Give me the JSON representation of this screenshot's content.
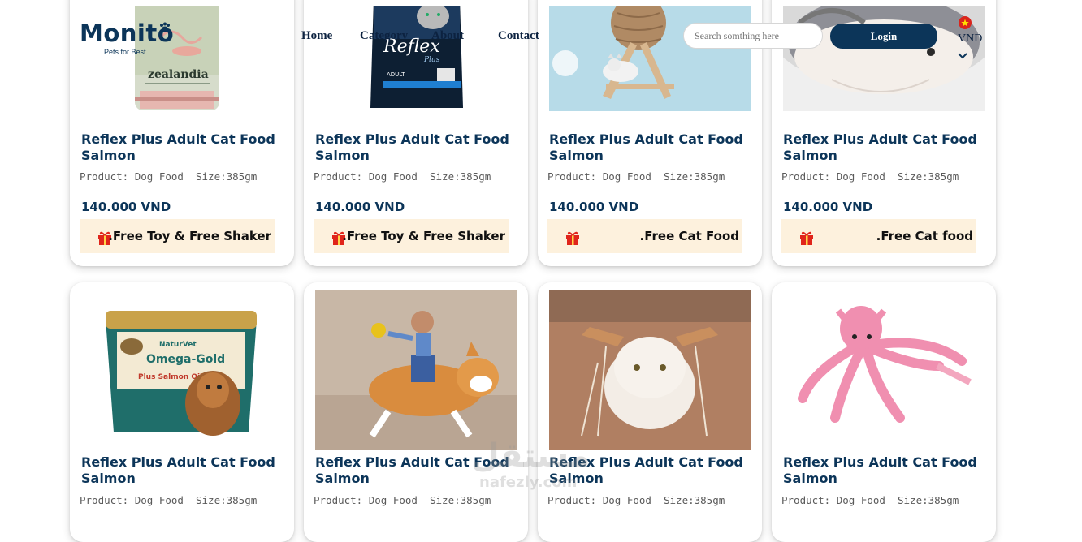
{
  "header": {
    "logo": "Monito",
    "tagline": "Pets for Best",
    "nav": [
      "Home",
      "Category",
      "About",
      "Contact"
    ],
    "search_placeholder": "Search somthing here",
    "login_label": "Login",
    "currency": "VND"
  },
  "products": [
    {
      "title": "Reflex Plus Adult Cat Food Salmon",
      "meta": "Product: Dog Food  Size:385gm",
      "price": "140.000 VND",
      "promo": ".Free Toy & Free Shaker",
      "image": "zealandia-can"
    },
    {
      "title": "Reflex Plus Adult Cat Food Salmon",
      "meta": "Product: Dog Food  Size:385gm",
      "price": "140.000 VND",
      "promo": ".Free Toy & Free Shaker",
      "image": "reflex-bag"
    },
    {
      "title": "Reflex Plus Adult Cat Food Salmon",
      "meta": "Product: Dog Food  Size:385gm",
      "price": "140.000 VND",
      "promo": ".Free Cat Food",
      "image": "cat-scratcher-ball"
    },
    {
      "title": "Reflex Plus Adult Cat Food Salmon",
      "meta": "Product: Dog Food  Size:385gm",
      "price": "140.000 VND",
      "promo": ".Free Cat food",
      "image": "shark-pet-bed"
    },
    {
      "title": "Reflex Plus Adult Cat Food Salmon",
      "meta": "Product: Dog Food  Size:385gm",
      "image": "naturvet-omega-gold"
    },
    {
      "title": "Reflex Plus Adult Cat Food Salmon",
      "meta": "Product: Dog Food  Size:385gm",
      "image": "corgi-rider-costume"
    },
    {
      "title": "Reflex Plus Adult Cat Food Salmon",
      "meta": "Product: Dog Food  Size:385gm",
      "image": "cat-antler-costume"
    },
    {
      "title": "Reflex Plus Adult Cat Food Salmon",
      "meta": "Product: Dog Food  Size:385gm",
      "image": "pink-squid-toy"
    }
  ],
  "colors": {
    "brand": "#0c3559",
    "promo_bg": "#fdf1dd",
    "gift": "#e0251b"
  },
  "watermark": {
    "arabic": "مستقل",
    "latin": "nafezly.com"
  }
}
